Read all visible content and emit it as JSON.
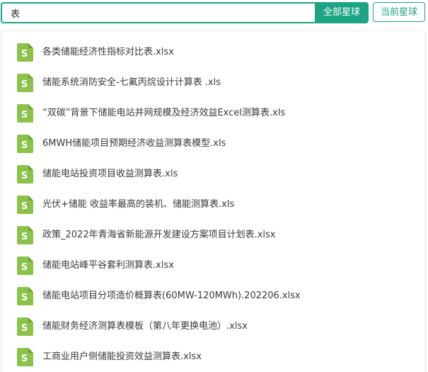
{
  "search": {
    "value": "表",
    "placeholder": ""
  },
  "buttons": {
    "all_planets": "全部星球",
    "current_planet": "当前星球"
  },
  "colors": {
    "accent": "#1ea385",
    "file_icon": "#8bc34a"
  },
  "results": [
    {
      "icon": "sheet-file-icon",
      "name": "各类储能经济性指标对比表.xlsx"
    },
    {
      "icon": "sheet-file-icon",
      "name": "储能系统消防安全-七氟丙烷设计计算表 .xls"
    },
    {
      "icon": "sheet-file-icon",
      "name": "“双碳”背景下储能电站并网规模及经济效益Excel测算表.xls"
    },
    {
      "icon": "sheet-file-icon",
      "name": "6MWH储能项目预期经济收益测算表模型.xls"
    },
    {
      "icon": "sheet-file-icon",
      "name": "储能电站投资项目收益测算表.xls"
    },
    {
      "icon": "sheet-file-icon",
      "name": "光伏+储能 收益率最高的装机、储能测算表.xls"
    },
    {
      "icon": "sheet-file-icon",
      "name": "政策_2022年青海省新能源开发建设方案项目计划表.xlsx"
    },
    {
      "icon": "sheet-file-icon",
      "name": "储能电站峰平谷套利测算表.xlsx"
    },
    {
      "icon": "sheet-file-icon",
      "name": "储能电站项目分项造价概算表(60MW-120MWh).202206.xlsx"
    },
    {
      "icon": "sheet-file-icon",
      "name": "储能财务经济测算表模板（第八年更换电池）.xlsx"
    },
    {
      "icon": "sheet-file-icon",
      "name": "工商业用户侧储能投资效益测算表.xlsx"
    }
  ]
}
